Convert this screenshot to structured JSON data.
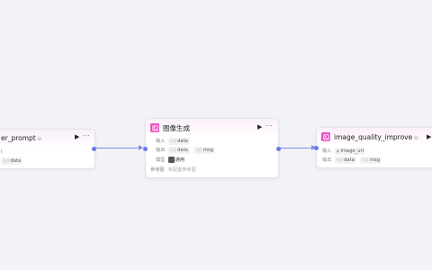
{
  "nodes": {
    "left": {
      "title": "er_prompt",
      "badge": "⛁",
      "row1_value": "t",
      "row2_tag": "data"
    },
    "center": {
      "title": "图像生成",
      "input_label": "输入",
      "input_tags": [
        "data"
      ],
      "output_label": "输出",
      "output_tags": [
        "data",
        "msg"
      ],
      "model_label": "模型",
      "model_value": "通用",
      "reference_label": "参考图",
      "reference_value": "未配置参考图"
    },
    "right": {
      "title": "image_quality_improve",
      "badge": "⛁",
      "input_label": "输入",
      "input_tags": [
        "image_url"
      ],
      "output_label": "输出",
      "output_tags": [
        "data",
        "msg"
      ]
    }
  },
  "icons": {
    "node_icon": "image-generation-icon",
    "run": "play-icon",
    "menu": "more-icon"
  },
  "colors": {
    "accent": "#e94fc0",
    "edge": "#7f8bea",
    "background": "#f2f3f7"
  }
}
